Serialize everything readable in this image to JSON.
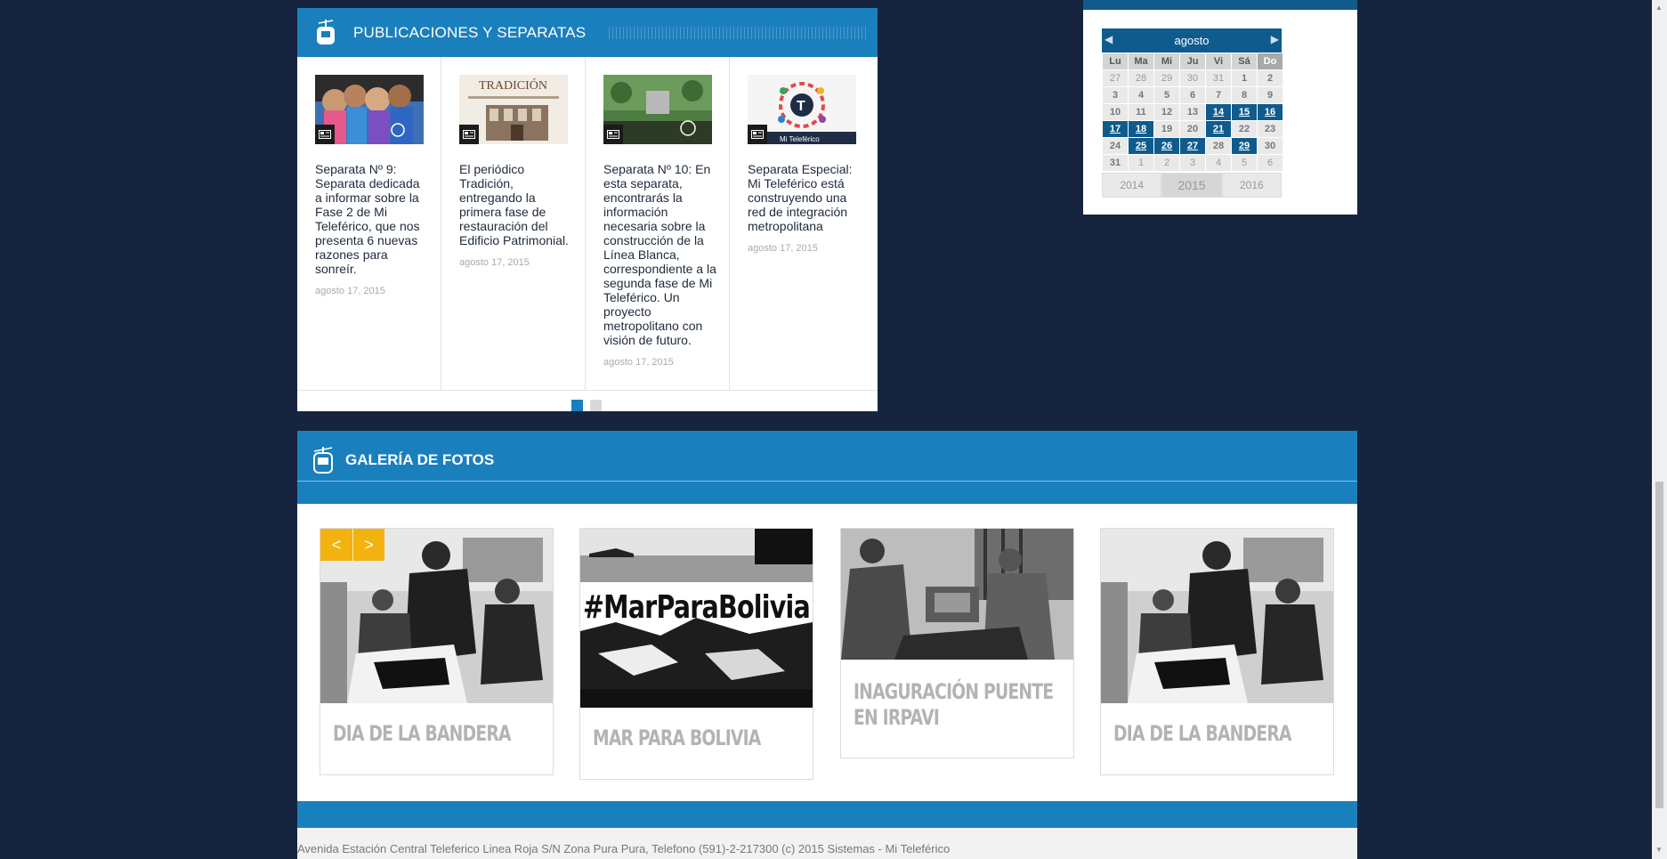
{
  "publicaciones": {
    "title": "PUBLICACIONES Y SEPARATAS",
    "items": [
      {
        "text": "Separata Nº 9: Separata dedicada a informar sobre la Fase 2 de Mi Teleférico, que nos presenta 6 nuevas razones para sonreír.",
        "date": "agosto 17, 2015"
      },
      {
        "text": "El periódico Tradición, entregando la primera fase de restauración del Edificio Patrimonial.",
        "date": "agosto 17, 2015",
        "thumb_label": "TRADICIÓN"
      },
      {
        "text": "Separata Nº 10: En esta separata, encontrarás la información necesaria sobre la construcción de la Línea Blanca, correspondiente a la segunda fase de Mi Teleférico. Un proyecto metropolitano con visión de futuro.",
        "date": "agosto 17, 2015"
      },
      {
        "text": "Separata Especial: Mi Teleférico está construyendo una red de integración metropolitana",
        "date": "agosto 17, 2015",
        "thumb_label": "Mi Teleférico"
      }
    ],
    "pager": {
      "pages": 2,
      "active": 1
    }
  },
  "calendar": {
    "month": "agosto",
    "prev_icon": "left-triangle-icon",
    "next_icon": "right-triangle-icon",
    "weekdays": [
      "Lu",
      "Ma",
      "Mi",
      "Ju",
      "Vi",
      "Sá",
      "Do"
    ],
    "weeks": [
      [
        {
          "d": "27",
          "t": "out"
        },
        {
          "d": "28",
          "t": "out"
        },
        {
          "d": "29",
          "t": "out"
        },
        {
          "d": "30",
          "t": "out"
        },
        {
          "d": "31",
          "t": "out"
        },
        {
          "d": "1",
          "t": "in"
        },
        {
          "d": "2",
          "t": "in"
        }
      ],
      [
        {
          "d": "3",
          "t": "in"
        },
        {
          "d": "4",
          "t": "in"
        },
        {
          "d": "5",
          "t": "in"
        },
        {
          "d": "6",
          "t": "in"
        },
        {
          "d": "7",
          "t": "in"
        },
        {
          "d": "8",
          "t": "in"
        },
        {
          "d": "9",
          "t": "in"
        }
      ],
      [
        {
          "d": "10",
          "t": "in"
        },
        {
          "d": "11",
          "t": "in"
        },
        {
          "d": "12",
          "t": "in"
        },
        {
          "d": "13",
          "t": "in"
        },
        {
          "d": "14",
          "t": "link"
        },
        {
          "d": "15",
          "t": "link"
        },
        {
          "d": "16",
          "t": "link"
        }
      ],
      [
        {
          "d": "17",
          "t": "link"
        },
        {
          "d": "18",
          "t": "link"
        },
        {
          "d": "19",
          "t": "in"
        },
        {
          "d": "20",
          "t": "in"
        },
        {
          "d": "21",
          "t": "link"
        },
        {
          "d": "22",
          "t": "in"
        },
        {
          "d": "23",
          "t": "in"
        }
      ],
      [
        {
          "d": "24",
          "t": "in"
        },
        {
          "d": "25",
          "t": "link"
        },
        {
          "d": "26",
          "t": "link"
        },
        {
          "d": "27",
          "t": "link"
        },
        {
          "d": "28",
          "t": "in"
        },
        {
          "d": "29",
          "t": "link"
        },
        {
          "d": "30",
          "t": "in"
        }
      ],
      [
        {
          "d": "31",
          "t": "in"
        },
        {
          "d": "1",
          "t": "out"
        },
        {
          "d": "2",
          "t": "out"
        },
        {
          "d": "3",
          "t": "out"
        },
        {
          "d": "4",
          "t": "out"
        },
        {
          "d": "5",
          "t": "out"
        },
        {
          "d": "6",
          "t": "out"
        }
      ]
    ],
    "years": {
      "prev": "2014",
      "current": "2015",
      "next": "2016"
    }
  },
  "galeria": {
    "title": "GALERÍA DE FOTOS",
    "nav": {
      "prev": "<",
      "next": ">"
    },
    "items": [
      {
        "title": "DIA DE LA BANDERA"
      },
      {
        "title": "MAR PARA BOLIVIA",
        "image_text": "#MarParaBolivia"
      },
      {
        "title": "INAGURACIÓN PUENTE EN IRPAVI"
      },
      {
        "title": "DIA DE LA BANDERA"
      }
    ]
  },
  "footer": {
    "text": "Avenida Estación Central Teleferico Linea Roja S/N Zona Pura Pura, Telefono (591)-2-217300 (c) 2015 Sistemas - Mi Teleférico"
  },
  "colors": {
    "page_bg": "#16243f",
    "accent": "#1a7fbd",
    "calendar_accent": "#0f5b8c",
    "gallery_nav": "#f3b20f"
  }
}
